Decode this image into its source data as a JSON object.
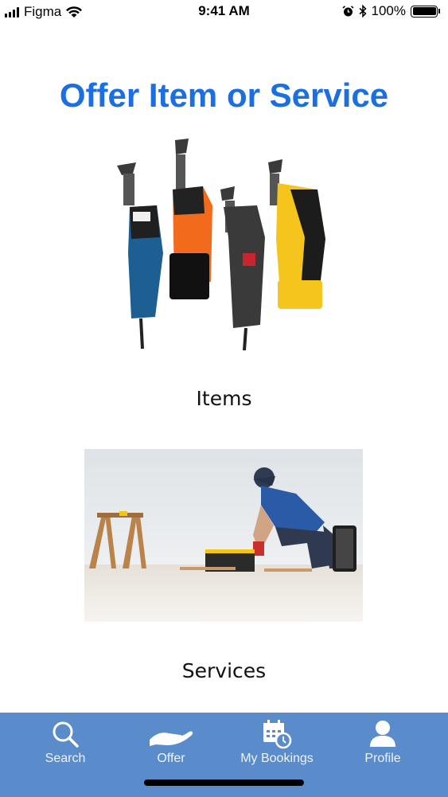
{
  "status_bar": {
    "carrier": "Figma",
    "time": "9:41 AM",
    "battery": "100%",
    "icons": [
      "signal-bars-icon",
      "wifi-icon",
      "alarm-icon",
      "bluetooth-icon",
      "battery-icon"
    ]
  },
  "page": {
    "title": "Offer Item or Service",
    "title_color": "#1b6fe0"
  },
  "options": {
    "items_label": "Items",
    "services_label": "Services"
  },
  "tab_bar": {
    "background": "#5a8ccc",
    "tabs": [
      {
        "label": "Search",
        "icon": "search-icon"
      },
      {
        "label": "Offer",
        "icon": "offer-hand-icon"
      },
      {
        "label": "My Bookings",
        "icon": "calendar-clock-icon"
      },
      {
        "label": "Profile",
        "icon": "person-icon"
      }
    ]
  }
}
